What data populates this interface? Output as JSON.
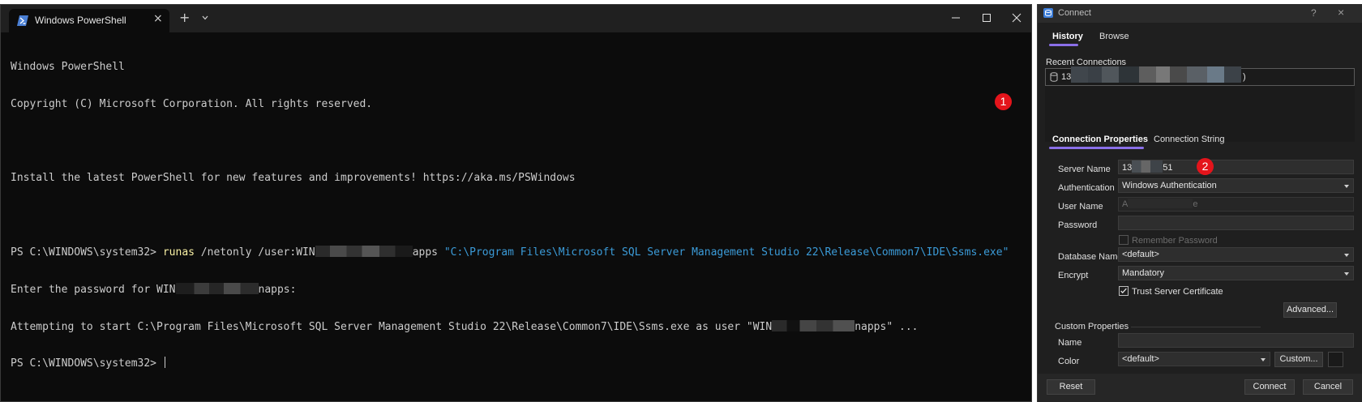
{
  "terminal": {
    "tab_title": "Windows PowerShell",
    "tab_close_glyph": "×",
    "new_tab_glyph": "+",
    "line_banner": "Windows PowerShell",
    "line_copyright": "Copyright (C) Microsoft Corporation. All rights reserved.",
    "line_install": "Install the latest PowerShell for new features and improvements! https://aka.ms/PSWindows",
    "cmd": {
      "prompt": "PS C:\\WINDOWS\\system32> ",
      "keyword": "runas",
      "args_before": " /netonly /user:WIN",
      "args_after": "apps ",
      "path": "\"C:\\Program Files\\Microsoft SQL Server Management Studio 22\\Release\\Common7\\IDE\\Ssms.exe\""
    },
    "line_password": {
      "before": "Enter the password for WIN",
      "after": "napps:"
    },
    "line_attempt": {
      "before": "Attempting to start C:\\Program Files\\Microsoft SQL Server Management Studio 22\\Release\\Common7\\IDE\\Ssms.exe as user \"WIN",
      "after": "napps\" ..."
    },
    "line_prompt_end": "PS C:\\WINDOWS\\system32> ",
    "badge_1": "1"
  },
  "dialog": {
    "title": "Connect",
    "help_glyph": "?",
    "close_glyph": "×",
    "tabs": [
      {
        "label": "History",
        "active": true
      },
      {
        "label": "Browse",
        "active": false
      }
    ],
    "recent_label": "Recent Connections",
    "recent_item_prefix": "13",
    "recent_item_suffix": ")",
    "props_tabs": [
      {
        "label": "Connection Properties",
        "active": true
      },
      {
        "label": "Connection String",
        "active": false
      }
    ],
    "server_name": {
      "label": "Server Name",
      "prefix": "13",
      "suffix": "51"
    },
    "badge_2": "2",
    "authentication": {
      "label": "Authentication",
      "value": "Windows Authentication"
    },
    "user_name": {
      "label": "User Name",
      "prefix": "A",
      "suffix": "e"
    },
    "password": {
      "label": "Password",
      "value": ""
    },
    "remember_password": {
      "label": "Remember Password",
      "checked": false
    },
    "database_name": {
      "label": "Database Name",
      "value": "<default>"
    },
    "encrypt": {
      "label": "Encrypt",
      "value": "Mandatory"
    },
    "trust_cert": {
      "label": "Trust Server Certificate",
      "checked": true
    },
    "advanced_label": "Advanced...",
    "custom_properties_label": "Custom Properties",
    "name": {
      "label": "Name",
      "value": ""
    },
    "color": {
      "label": "Color",
      "value": "<default>"
    },
    "custom_label": "Custom...",
    "reset_label": "Reset",
    "connect_label": "Connect",
    "cancel_label": "Cancel"
  },
  "colors": {
    "terminal_bg": "#0c0c0c",
    "keyword": "#f9f1a5",
    "string": "#3b9bd8",
    "badge": "#e4141b",
    "accent_tab": "#8a6fe8"
  }
}
